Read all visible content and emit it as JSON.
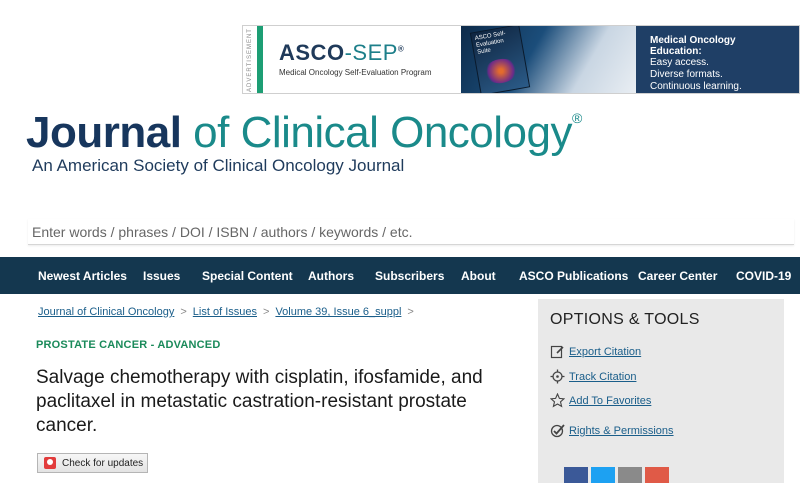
{
  "ad": {
    "vertical_label": "ADVERTISEMENT",
    "brand_main": "ASCO",
    "brand_suffix": "-SEP",
    "brand_reg": "®",
    "tagline": "Medical Oncology Self-Evaluation Program",
    "book_text": "ASCO Self-Evaluation Suite",
    "headline": "Medical Oncology Education:",
    "lines": [
      "Easy access.",
      "Diverse formats.",
      "Continuous learning."
    ]
  },
  "masthead": {
    "title_bold": "Journal",
    "title_rest": " of Clinical Oncology",
    "reg": "®",
    "subtitle": "An American Society of Clinical Oncology Journal"
  },
  "search": {
    "placeholder": "Enter words / phrases / DOI / ISBN / authors / keywords / etc."
  },
  "nav": {
    "items": [
      "Newest Articles",
      "Issues",
      "Special Content",
      "Authors",
      "Subscribers",
      "About",
      "ASCO Publications",
      "Career Center",
      "COVID-19"
    ]
  },
  "breadcrumb": {
    "items": [
      "Journal of Clinical Oncology",
      "List of Issues",
      "Volume 39, Issue 6_suppl"
    ],
    "separator": ">"
  },
  "article": {
    "section": "PROSTATE CANCER - ADVANCED",
    "title": "Salvage chemotherapy with cisplatin, ifosfamide, and paclitaxel in metastatic castration-resistant prostate cancer.",
    "check_updates": "Check for updates"
  },
  "tools": {
    "title": "OPTIONS & TOOLS",
    "items": [
      {
        "label": "Export Citation",
        "icon": "edit-icon"
      },
      {
        "label": "Track Citation",
        "icon": "crosshair-icon"
      },
      {
        "label": "Add To Favorites",
        "icon": "star-icon"
      },
      {
        "label": "Rights & Permissions",
        "icon": "check-circle-icon"
      }
    ],
    "share_colors": [
      "#3b5998",
      "#1da1f2",
      "#8a8a8a",
      "#e05a47"
    ]
  }
}
